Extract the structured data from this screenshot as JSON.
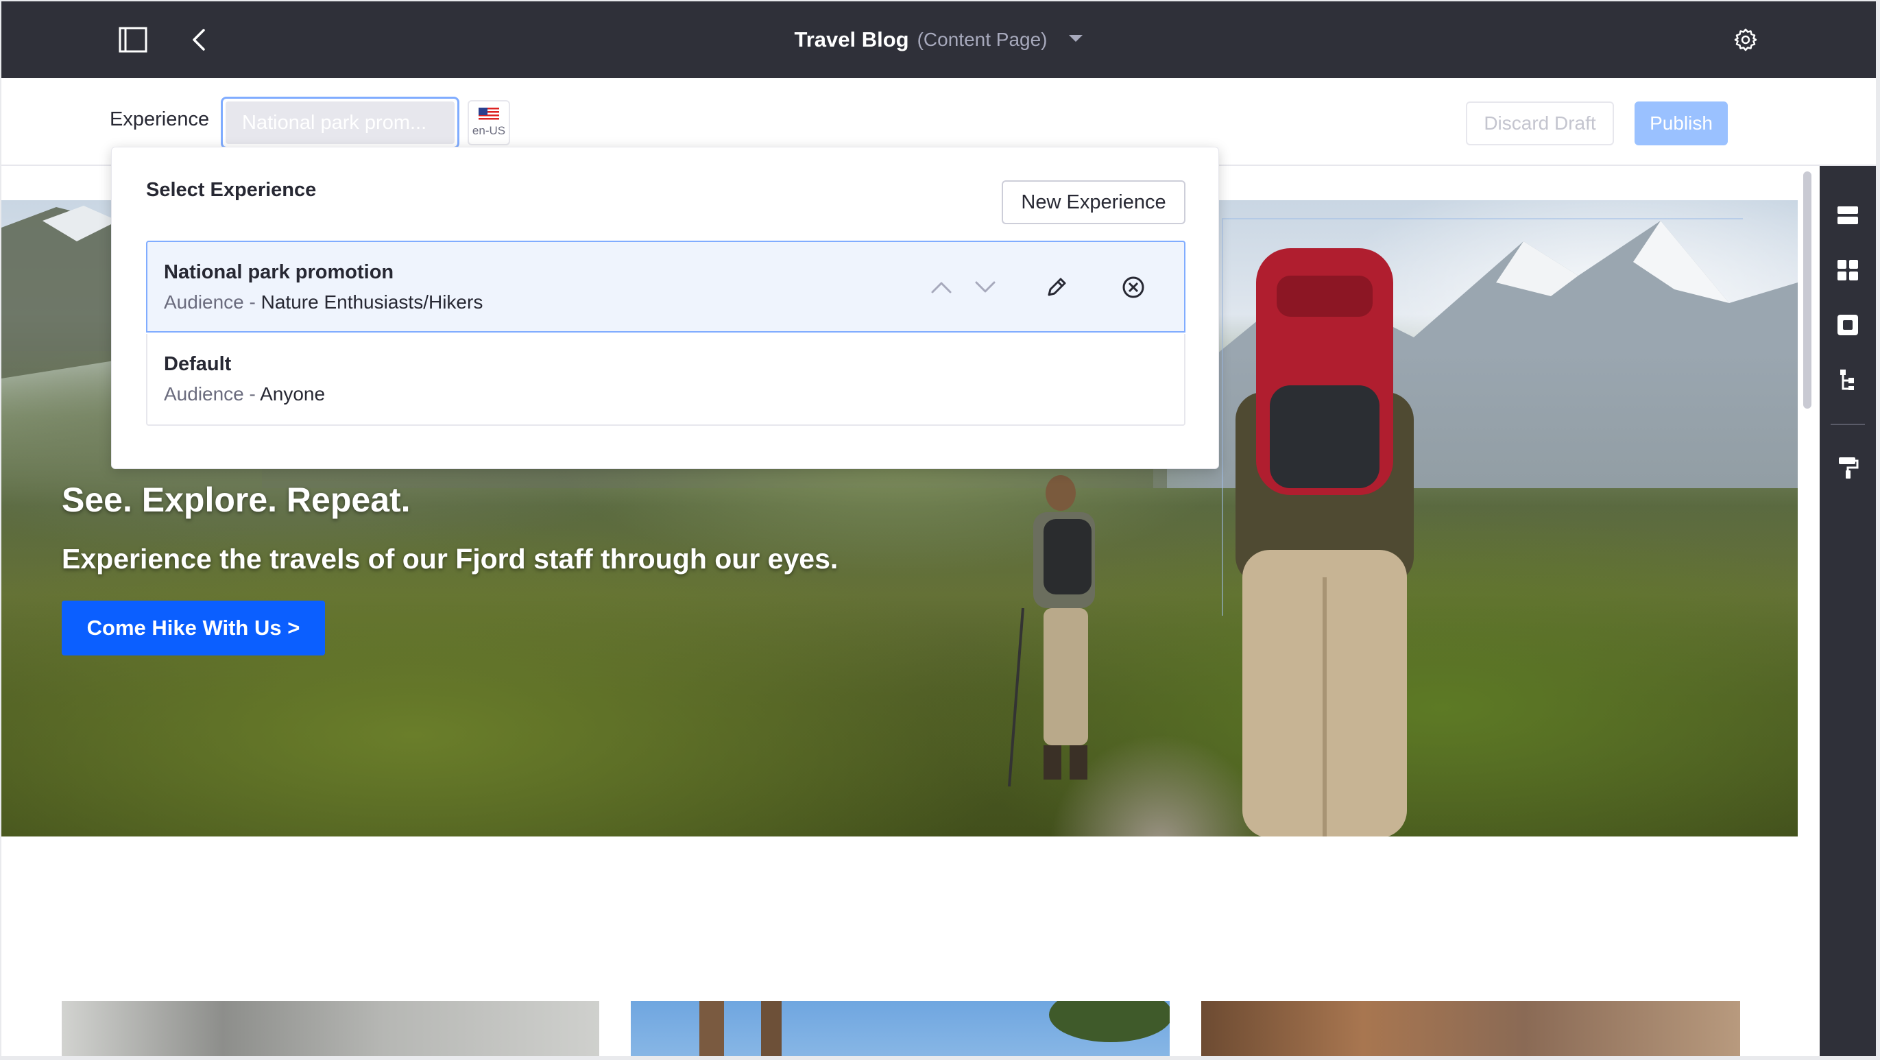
{
  "topbar": {
    "page_title": "Travel Blog",
    "page_type": "(Content Page)",
    "icons": [
      "sidebar-toggle-icon",
      "back-arrow-icon",
      "caret-down-icon",
      "gear-icon"
    ]
  },
  "toolbar": {
    "experience_label": "Experience",
    "experience_selected": "National park prom...",
    "language": "en-US",
    "discard_label": "Discard Draft",
    "publish_label": "Publish"
  },
  "dropdown": {
    "title": "Select Experience",
    "new_button": "New Experience",
    "items": [
      {
        "name": "National park promotion",
        "audience_key": "Audience - ",
        "audience_value": "Nature Enthusiasts/Hikers",
        "active": true
      },
      {
        "name": "Default",
        "audience_key": "Audience - ",
        "audience_value": "Anyone",
        "active": false
      }
    ]
  },
  "hero": {
    "title": "See. Explore. Repeat.",
    "subtitle": "Experience the travels of our Fjord staff through our eyes.",
    "cta": "Come Hike With Us >"
  },
  "colors": {
    "topbar_bg": "#2f3039",
    "primary": "#0b5fff",
    "publish_disabled": "#9ac1ff",
    "active_item_bg": "#eff4fd",
    "active_item_border": "#80acff"
  }
}
